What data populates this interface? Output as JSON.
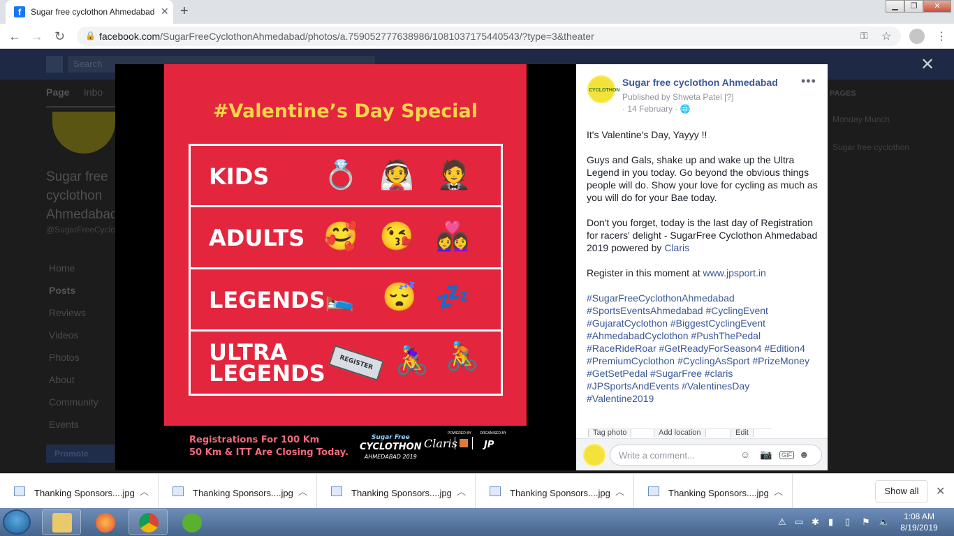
{
  "browser": {
    "tab_title": "Sugar free cyclothon Ahmedabad",
    "tab_close": "✕",
    "new_tab": "+",
    "url_host": "facebook.com",
    "url_path": "/SugarFreeCyclothonAhmedabad/photos/a.759052777638986/1081037175440543/?type=3&theater",
    "win_min": "▁",
    "win_max": "❐",
    "win_close": "✕"
  },
  "background": {
    "search": "Search",
    "tab_page": "Page",
    "tab_inbox": "Inbo",
    "page_name": "Sugar free cyclothon Ahmedabad",
    "page_handle": "@SugarFreeCyclothonAhmedabad",
    "nav": [
      "Home",
      "Posts",
      "Reviews",
      "Videos",
      "Photos",
      "About",
      "Community",
      "Events"
    ],
    "promote": "Promote",
    "right_header": "PAGES",
    "right_items": [
      "Monday Munch",
      "Sugar free cyclothon"
    ]
  },
  "poster": {
    "title": "#Valentine’s Day Special",
    "rows": [
      {
        "label": "KIDS",
        "emojis": [
          "💍",
          "👰",
          "🤵"
        ]
      },
      {
        "label": "ADULTS",
        "emojis": [
          "🥰",
          "😘",
          "👩‍❤️‍👩"
        ]
      },
      {
        "label": "LEGENDS",
        "emojis": [
          "🛌",
          "😴",
          "💤"
        ]
      },
      {
        "label_line1": "ULTRA",
        "label_line2": "LEGENDS",
        "emojis": [
          "⌨",
          "🚴‍♀️",
          "🚴"
        ]
      }
    ],
    "register_tag": "REGISTER",
    "footer_line1": "Registrations For 100 Km",
    "footer_line2": "50 Km & ITT Are Closing Today.",
    "logo_sugar": "Sugar Free",
    "logo_name": "CYCLOTHON",
    "logo_city": "AHMEDABAD 2019",
    "powered": "POWERED BY",
    "claris": "Claris",
    "organised": "ORGANISED BY"
  },
  "panel": {
    "page_name": "Sugar free cyclothon Ahmedabad",
    "published": "Published by Shweta Patel [?]",
    "date": "· 14 February · 🌐",
    "more": "•••",
    "p1": "It's Valentine's Day, Yayyy !!",
    "p2": "Guys and Gals, shake up and wake up the Ultra Legend in you today. Go beyond the obvious things people will do. Show your love for cycling as much as you will do for your Bae today.",
    "p3": "Don't you forget, today is the last day of Registration for racers' delight - SugarFree Cyclothon Ahmedabad 2019 powered by ",
    "p3_link": "Claris",
    "p4": "Register in this moment at ",
    "p4_link": "www.jpsport.in",
    "hashtags": [
      "#SugarFreeCyclothonAhmedabad",
      "#SportsEventsAhmedabad #CyclingEvent",
      "#GujaratCyclothon #BiggestCyclingEvent",
      "#AhmedabadCyclothon #PushThePedal",
      "#RaceRideRoar #GetReadyForSeason4 #Edition4",
      "#PremiumCyclothon #CyclingAsSport #PrizeMoney",
      "#GetSetPedal #SugarFree #claris",
      "#JPSportsAndEvents #ValentinesDay",
      "#Valentine2019"
    ],
    "tag_photo": "Tag photo",
    "add_location": "Add location",
    "edit": "Edit",
    "comment_placeholder": "Write a comment...",
    "close": "✕"
  },
  "downloads": {
    "items": [
      "Thanking Sponsors....jpg",
      "Thanking Sponsors....jpg",
      "Thanking Sponsors....jpg",
      "Thanking Sponsors....jpg",
      "Thanking Sponsors....jpg"
    ],
    "show_all": "Show all",
    "close": "✕"
  },
  "taskbar": {
    "time": "1:08 AM",
    "date": "8/19/2019"
  }
}
